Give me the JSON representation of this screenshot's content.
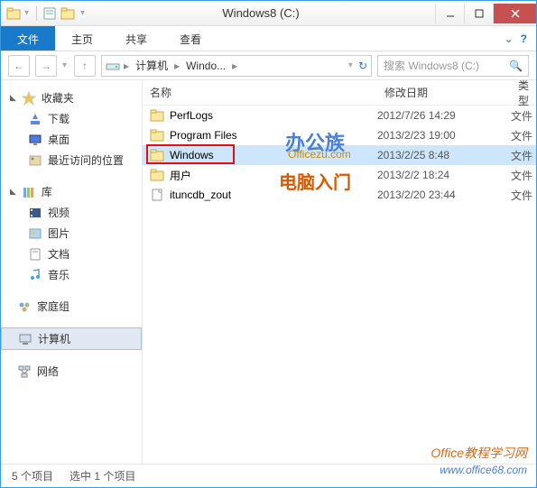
{
  "title": "Windows8 (C:)",
  "ribbon": {
    "file": "文件",
    "home": "主页",
    "share": "共享",
    "view": "查看"
  },
  "breadcrumb": {
    "computer": "计算机",
    "drive": "Windo..."
  },
  "search": {
    "placeholder": "搜索 Windows8 (C:)"
  },
  "columns": {
    "name": "名称",
    "date": "修改日期",
    "type": "类型"
  },
  "sidebar": {
    "favorites": {
      "label": "收藏夹",
      "items": [
        "下载",
        "桌面",
        "最近访问的位置"
      ]
    },
    "libraries": {
      "label": "库",
      "items": [
        "视频",
        "图片",
        "文档",
        "音乐"
      ]
    },
    "homegroup": "家庭组",
    "computer": "计算机",
    "network": "网络"
  },
  "files": [
    {
      "name": "PerfLogs",
      "date": "2012/7/26 14:29",
      "type": "文件",
      "icon": "folder",
      "selected": false
    },
    {
      "name": "Program Files",
      "date": "2013/2/23 19:00",
      "type": "文件",
      "icon": "folder",
      "selected": false
    },
    {
      "name": "Windows",
      "date": "2013/2/25 8:48",
      "type": "文件",
      "icon": "folder",
      "selected": true
    },
    {
      "name": "用户",
      "date": "2013/2/2 18:24",
      "type": "文件",
      "icon": "folder",
      "selected": false
    },
    {
      "name": "ituncdb_zout",
      "date": "2013/2/20 23:44",
      "type": "文件",
      "icon": "file",
      "selected": false
    }
  ],
  "status": {
    "count": "5 个项目",
    "selected": "选中 1 个项目"
  },
  "watermarks": {
    "w1": "办公族",
    "w1b": "Officezu.com",
    "w2": "电脑入门",
    "w3": "Office教程学习网",
    "w3b": "www.office68.com"
  }
}
